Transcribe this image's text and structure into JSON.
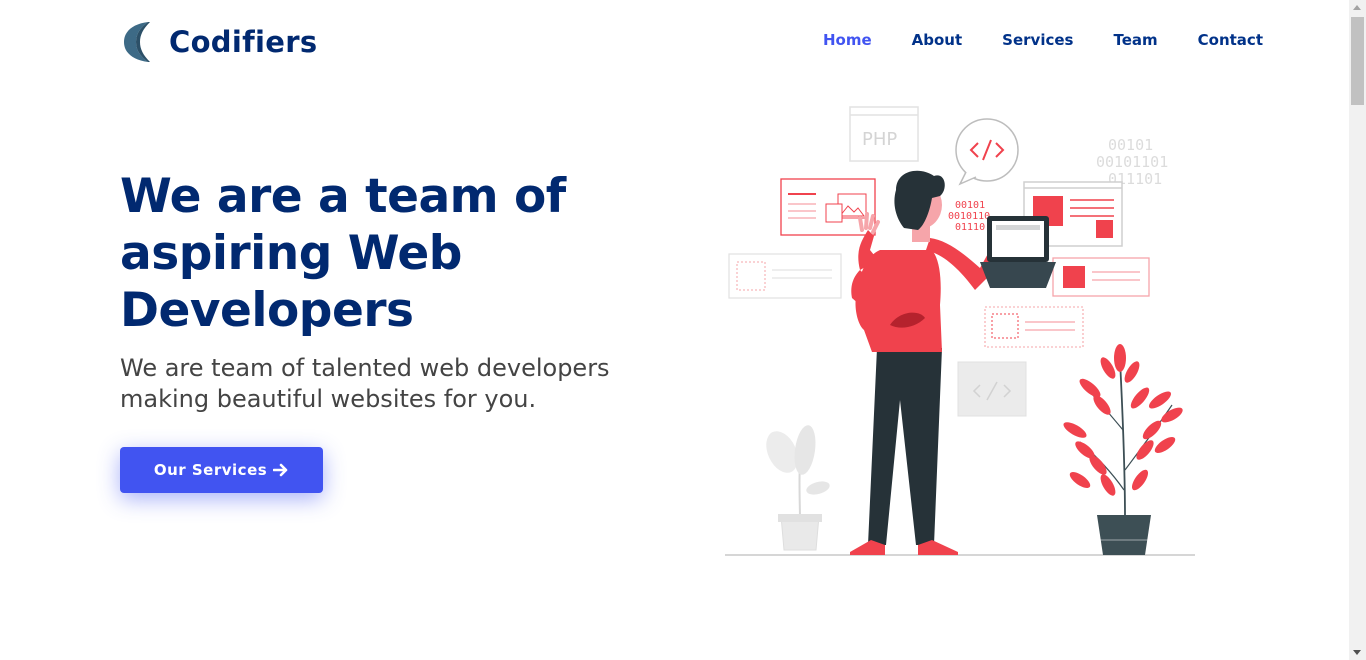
{
  "brand": {
    "name": "Codifiers",
    "logo_icon": "crescent-logo-icon",
    "color": "#012970"
  },
  "nav": {
    "items": [
      {
        "label": "Home",
        "active": true
      },
      {
        "label": "About",
        "active": false
      },
      {
        "label": "Services",
        "active": false
      },
      {
        "label": "Team",
        "active": false
      },
      {
        "label": "Contact",
        "active": false
      }
    ],
    "active_color": "#4154f1",
    "color": "#013289"
  },
  "hero": {
    "title": "We are a team of aspiring Web Developers",
    "subtitle": "We are team of talented web developers making beautiful websites for you.",
    "cta_label": "Our Services",
    "cta_icon": "arrow-right-icon",
    "cta_color": "#4154f1"
  },
  "illustration": {
    "icon": "web-developer-illustration",
    "labels": {
      "php": "PHP",
      "binary1": "00101",
      "binary2": "00101101",
      "binary3": "011101",
      "binary4": "00101",
      "binary5": "0010110",
      "binary6": "01110"
    },
    "accent": "#f0424d"
  }
}
